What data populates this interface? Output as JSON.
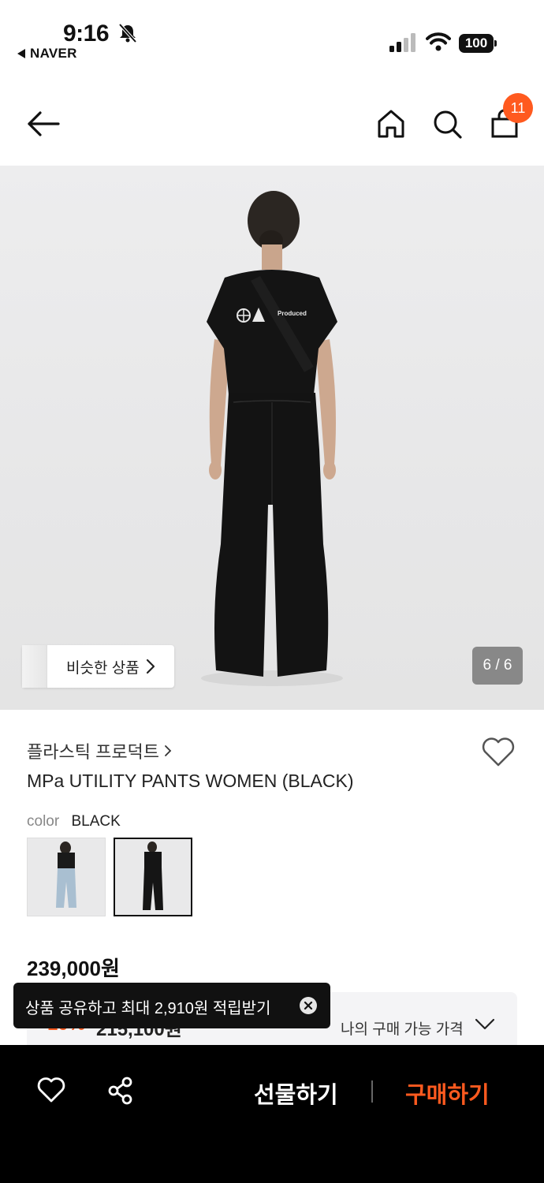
{
  "status_bar": {
    "time": "9:16",
    "back_app": "NAVER",
    "battery": "100"
  },
  "nav": {
    "cart_count": "11"
  },
  "hero": {
    "similar_label": "비슷한 상품",
    "page_counter": "6 / 6",
    "print_text": "Produced"
  },
  "product": {
    "brand": "플라스틱 프로덕트",
    "name": "MPa UTILITY PANTS WOMEN (BLACK)",
    "color_key": "color",
    "color_value": "BLACK",
    "price": "239,000원",
    "discount": "10%",
    "orig_price": "215,100원",
    "my_price_label": "나의 구매 가능 가격"
  },
  "toast": {
    "text": "상품 공유하고 최대 2,910원 적립받기"
  },
  "bottom_bar": {
    "gift_label": "선물하기",
    "buy_label": "구매하기"
  },
  "colors": {
    "accent": "#ff5a1f",
    "bar_bg": "#000000"
  }
}
